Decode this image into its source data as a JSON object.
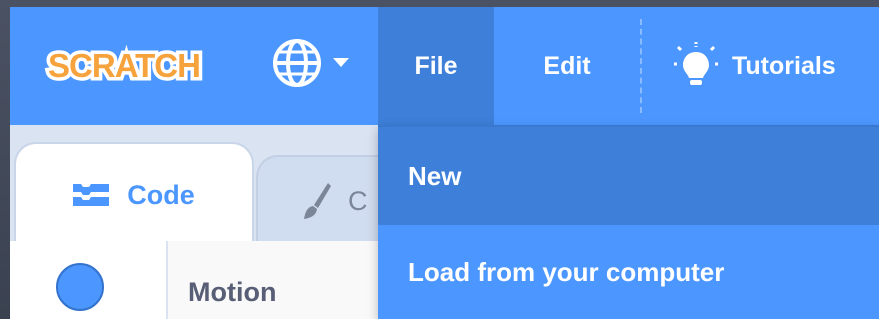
{
  "menubar": {
    "logo_text": "SCRATCH",
    "language_icon": "globe-icon",
    "file_label": "File",
    "edit_label": "Edit",
    "tutorials_label": "Tutorials",
    "tutorials_icon": "lightbulb-icon"
  },
  "file_menu": {
    "items": [
      {
        "label": "New"
      },
      {
        "label": "Load from your computer"
      }
    ]
  },
  "tabs": {
    "code_label": "Code",
    "costumes_label": "C"
  },
  "categories": {
    "motion_label": "Motion"
  },
  "colors": {
    "menu_blue": "#4c97ff",
    "menu_active": "#3d7fd9",
    "logo_orange": "#f7a33d"
  }
}
